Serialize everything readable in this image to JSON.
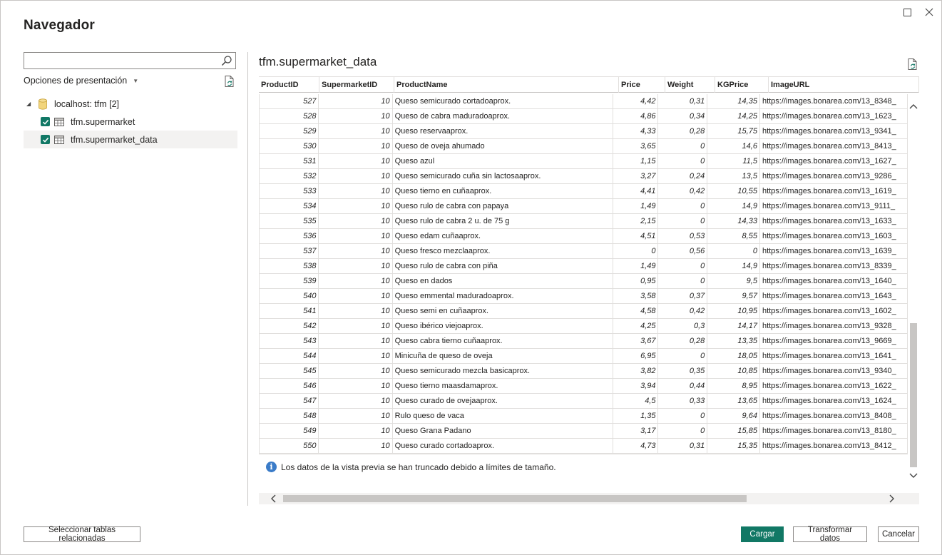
{
  "window": {
    "title": "Navegador"
  },
  "left_panel": {
    "search": {
      "value": "",
      "placeholder": ""
    },
    "display_options_label": "Opciones de presentación",
    "tree": {
      "root": {
        "label": "localhost: tfm [2]",
        "icon": "database-icon"
      },
      "items": [
        {
          "label": "tfm.supermarket",
          "checked": true,
          "selected": false
        },
        {
          "label": "tfm.supermarket_data",
          "checked": true,
          "selected": true
        }
      ]
    }
  },
  "preview": {
    "title": "tfm.supermarket_data",
    "columns": [
      "ProductID",
      "SupermarketID",
      "ProductName",
      "Price",
      "Weight",
      "KGPrice",
      "ImageURL"
    ],
    "rows": [
      [
        "527",
        "10",
        "Queso semicurado cortadoaprox.",
        "4,42",
        "0,31",
        "14,35",
        "https://images.bonarea.com/13_8348_"
      ],
      [
        "528",
        "10",
        "Queso de cabra maduradoaprox.",
        "4,86",
        "0,34",
        "14,25",
        "https://images.bonarea.com/13_1623_"
      ],
      [
        "529",
        "10",
        "Queso reservaaprox.",
        "4,33",
        "0,28",
        "15,75",
        "https://images.bonarea.com/13_9341_"
      ],
      [
        "530",
        "10",
        "Queso de oveja ahumado",
        "3,65",
        "0",
        "14,6",
        "https://images.bonarea.com/13_8413_"
      ],
      [
        "531",
        "10",
        "Queso azul",
        "1,15",
        "0",
        "11,5",
        "https://images.bonarea.com/13_1627_"
      ],
      [
        "532",
        "10",
        "Queso semicurado cuña sin lactosaaprox.",
        "3,27",
        "0,24",
        "13,5",
        "https://images.bonarea.com/13_9286_"
      ],
      [
        "533",
        "10",
        "Queso tierno en cuñaaprox.",
        "4,41",
        "0,42",
        "10,55",
        "https://images.bonarea.com/13_1619_"
      ],
      [
        "534",
        "10",
        "Queso rulo de cabra con papaya",
        "1,49",
        "0",
        "14,9",
        "https://images.bonarea.com/13_9111_"
      ],
      [
        "535",
        "10",
        "Queso rulo de cabra 2 u. de 75 g",
        "2,15",
        "0",
        "14,33",
        "https://images.bonarea.com/13_1633_"
      ],
      [
        "536",
        "10",
        "Queso edam cuñaaprox.",
        "4,51",
        "0,53",
        "8,55",
        "https://images.bonarea.com/13_1603_"
      ],
      [
        "537",
        "10",
        "Queso fresco mezclaaprox.",
        "0",
        "0,56",
        "0",
        "https://images.bonarea.com/13_1639_"
      ],
      [
        "538",
        "10",
        "Queso rulo de cabra con piña",
        "1,49",
        "0",
        "14,9",
        "https://images.bonarea.com/13_8339_"
      ],
      [
        "539",
        "10",
        "Queso en dados",
        "0,95",
        "0",
        "9,5",
        "https://images.bonarea.com/13_1640_"
      ],
      [
        "540",
        "10",
        "Queso emmental maduradoaprox.",
        "3,58",
        "0,37",
        "9,57",
        "https://images.bonarea.com/13_1643_"
      ],
      [
        "541",
        "10",
        "Queso semi en cuñaaprox.",
        "4,58",
        "0,42",
        "10,95",
        "https://images.bonarea.com/13_1602_"
      ],
      [
        "542",
        "10",
        "Queso ibérico viejoaprox.",
        "4,25",
        "0,3",
        "14,17",
        "https://images.bonarea.com/13_9328_"
      ],
      [
        "543",
        "10",
        "Queso cabra tierno cuñaaprox.",
        "3,67",
        "0,28",
        "13,35",
        "https://images.bonarea.com/13_9669_"
      ],
      [
        "544",
        "10",
        "Minicuña de queso de oveja",
        "6,95",
        "0",
        "18,05",
        "https://images.bonarea.com/13_1641_"
      ],
      [
        "545",
        "10",
        "Queso semicurado mezcla basicaprox.",
        "3,82",
        "0,35",
        "10,85",
        "https://images.bonarea.com/13_9340_"
      ],
      [
        "546",
        "10",
        "Queso tierno maasdamaprox.",
        "3,94",
        "0,44",
        "8,95",
        "https://images.bonarea.com/13_1622_"
      ],
      [
        "547",
        "10",
        "Queso curado de ovejaaprox.",
        "4,5",
        "0,33",
        "13,65",
        "https://images.bonarea.com/13_1624_"
      ],
      [
        "548",
        "10",
        "Rulo queso de vaca",
        "1,35",
        "0",
        "9,64",
        "https://images.bonarea.com/13_8408_"
      ],
      [
        "549",
        "10",
        "Queso Grana Padano",
        "3,17",
        "0",
        "15,85",
        "https://images.bonarea.com/13_8180_"
      ],
      [
        "550",
        "10",
        "Queso curado cortadoaprox.",
        "4,73",
        "0,31",
        "15,35",
        "https://images.bonarea.com/13_8412_"
      ]
    ],
    "truncation_note": "Los datos de la vista previa se han truncado debido a límites de tamaño.",
    "vertical_scroll_fraction": 0.62,
    "horizontal_scroll_fraction": 0.0
  },
  "footer": {
    "related_tables_label": "Seleccionar tablas relacionadas",
    "load_label": "Cargar",
    "transform_label": "Transformar datos",
    "cancel_label": "Cancelar"
  },
  "colors": {
    "accent": "#117865",
    "info": "#3a7bc8",
    "border": "#8a8886",
    "grid_line": "#e1dfdd",
    "scroll_thumb": "#c8c6c4"
  }
}
